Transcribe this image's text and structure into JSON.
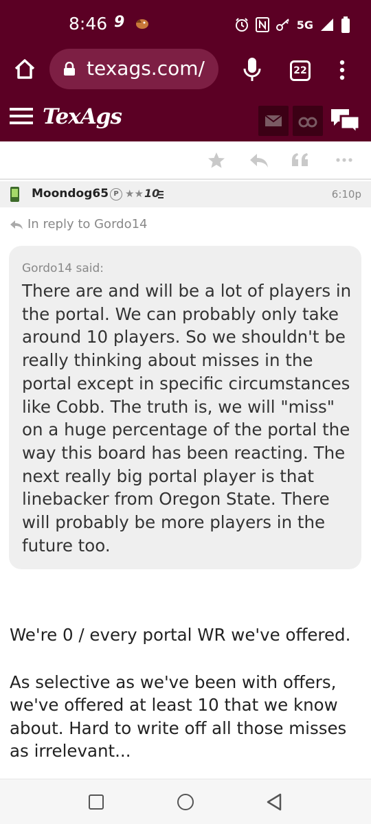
{
  "status_bar": {
    "time": "8:46",
    "indicator": "9",
    "network": "5G"
  },
  "browser": {
    "url": "texags.com/",
    "tab_count": "22"
  },
  "site": {
    "logo": "TexAgs",
    "brand_color": "#5b0024"
  },
  "post": {
    "author": "Moondog65",
    "badge": "P",
    "stars": "★★",
    "rank": "10",
    "time": "6:10p",
    "in_reply_to": "In reply to Gordo14",
    "quote": {
      "author_said": "Gordo14 said:",
      "text": "There are and will be a lot of players in the portal. We can probably only take around 10 players. So we shouldn't be really thinking about misses in the portal except in specific circumstances like Cobb. The truth is, we will \"miss\" on a huge percentage of the portal the way this board has been reacting. The next really big portal player is that linebacker from Oregon State. There will probably be more players in the future too."
    },
    "body": [
      "We're 0 / every portal WR we've offered.",
      "As selective as we've been with offers, we've offered at least 10 that we know about. Hard to write off all those misses as irrelevant..."
    ]
  },
  "icons": {
    "home": "home-icon",
    "lock": "lock-icon",
    "mic": "mic-icon",
    "menu": "kebab-menu-icon",
    "hamburger": "hamburger-icon",
    "mail": "mail-icon",
    "binoculars": "binoculars-icon",
    "chat": "chat-icon",
    "star": "star-icon",
    "reply": "reply-icon",
    "quote": "quote-icon",
    "more": "more-icon"
  }
}
